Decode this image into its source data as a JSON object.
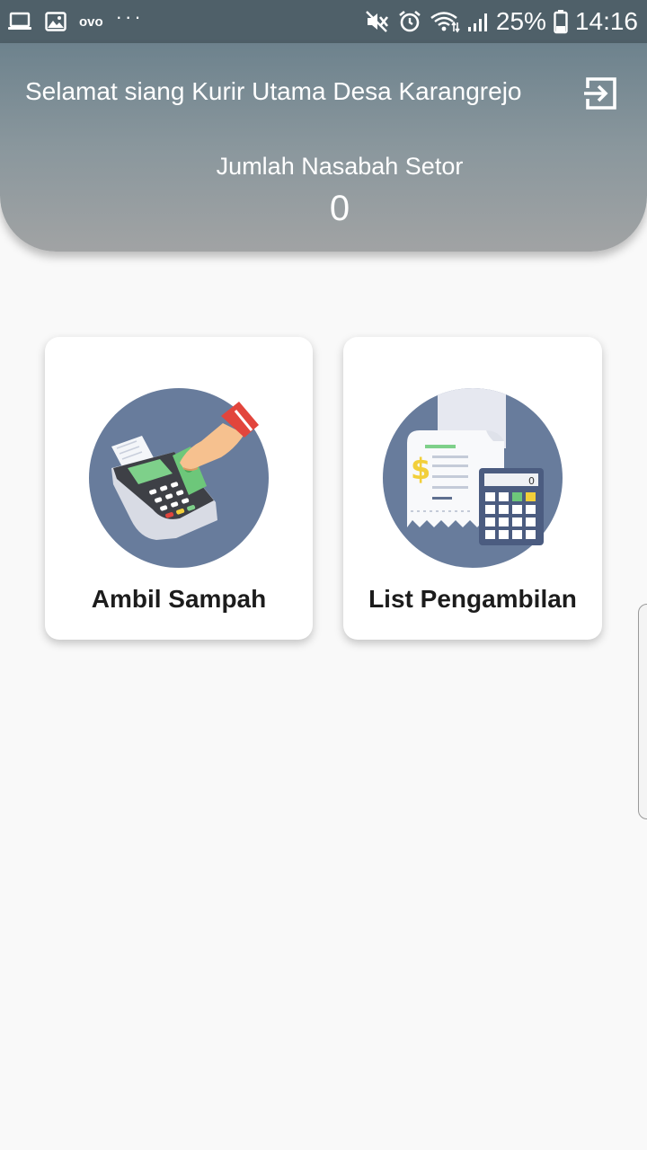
{
  "status_bar": {
    "left_icons": [
      "laptop-icon",
      "image-icon",
      "ovo-icon",
      "more-dots-icon"
    ],
    "ovo_label": "ovo",
    "dots": "···",
    "right_icons": [
      "mute-icon",
      "alarm-icon",
      "wifi-icon",
      "signal-icon",
      "battery-icon"
    ],
    "battery_percent": "25%",
    "time": "14:16"
  },
  "header": {
    "greeting": "Selamat siang Kurir Utama Desa Karangrejo",
    "logout_icon": "logout-icon",
    "count_label": "Jumlah Nasabah Setor",
    "count_value": "0"
  },
  "menu": {
    "items": [
      {
        "label": "Ambil Sampah",
        "icon": "payment-terminal-icon"
      },
      {
        "label": "List Pengambilan",
        "icon": "receipt-calculator-icon"
      }
    ],
    "calculator_display": "0"
  },
  "colors": {
    "status_bar": "#4f6069",
    "header_top": "#6d828d",
    "header_bottom": "#a1a3a4",
    "background": "#f9f9f9",
    "illustration_circle": "#687c9c",
    "hand_cuff": "#e2453c",
    "money_green": "#6dc77a",
    "dollar_yellow": "#f2cf3a"
  }
}
